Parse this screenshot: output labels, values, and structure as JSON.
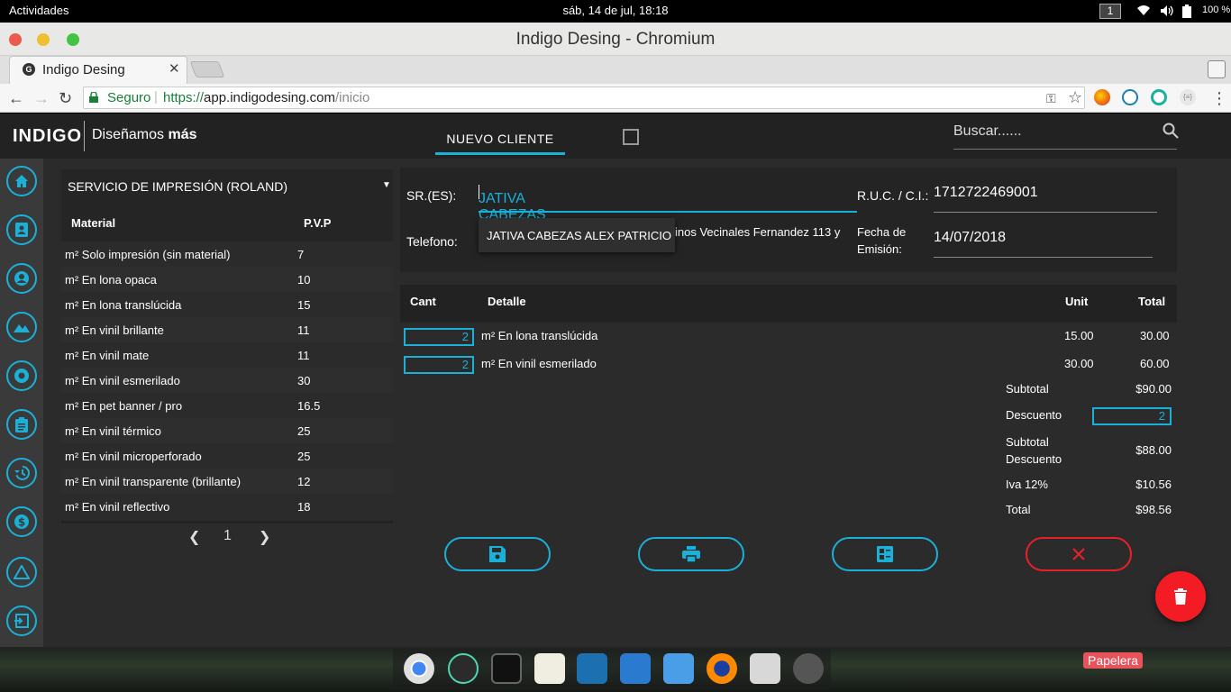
{
  "topbar": {
    "activities": "Actividades",
    "clock": "sáb, 14 de jul, 18:18",
    "workspace": "1",
    "battery": "100 %"
  },
  "window": {
    "title": "Indigo Desing - Chromium"
  },
  "browser": {
    "tab_title": "Indigo Desing",
    "secure_label": "Seguro",
    "url_scheme": "https://",
    "url_host": "app.indigodesing.com",
    "url_path": "/inicio"
  },
  "app": {
    "logo": "INDIGO",
    "tagline_regular": "Diseñamos ",
    "tagline_bold": "más",
    "nuevo_cliente": "NUEVO CLIENTE",
    "search_placeholder": "Buscar......",
    "accent": "#1ab0d8",
    "danger": "#f41c24"
  },
  "sidebar": {
    "icons": [
      "home-icon",
      "contacts-icon",
      "account-icon",
      "landscape-icon",
      "camera-icon",
      "assignment-icon",
      "history-icon",
      "money-icon",
      "warning-icon",
      "exit-icon"
    ]
  },
  "services": {
    "selected": "SERVICIO DE IMPRESIÓN (ROLAND)",
    "columns": [
      "Material",
      "P.V.P"
    ],
    "rows": [
      {
        "name": "m² Solo impresión (sin material)",
        "price": "7"
      },
      {
        "name": "m² En lona opaca",
        "price": "10"
      },
      {
        "name": "m² En lona translúcida",
        "price": "15"
      },
      {
        "name": "m² En vinil brillante",
        "price": "11"
      },
      {
        "name": "m² En vinil mate",
        "price": "11"
      },
      {
        "name": "m² En vinil esmerilado",
        "price": "30"
      },
      {
        "name": "m² En pet banner / pro",
        "price": "16.5"
      },
      {
        "name": "m² En vinil térmico",
        "price": "25"
      },
      {
        "name": "m² En vinil microperforado",
        "price": "25"
      },
      {
        "name": "m² En vinil transparente (brillante)",
        "price": "12"
      },
      {
        "name": "m² En vinil reflectivo",
        "price": "18"
      }
    ],
    "page": "1"
  },
  "form": {
    "sr_label": "SR.(ES):",
    "sr_value": "JATIVA CABEZAS ALEX PATRICIO",
    "ruc_label": "R.U.C. / C.I.:",
    "ruc_value": "1712722469001",
    "telefono_label": "Telefono:",
    "address_partial": "inos Vecinales Fernandez 113 y",
    "fecha_label_1": "Fecha de",
    "fecha_label_2": "Emisión:",
    "fecha_value": "14/07/2018",
    "autocomplete_option": "JATIVA CABEZAS ALEX PATRICIO"
  },
  "detail": {
    "columns": {
      "cant": "Cant",
      "detalle": "Detalle",
      "unit": "Unit",
      "total": "Total"
    },
    "rows": [
      {
        "cant": "2",
        "detalle": "m² En lona translúcida",
        "unit": "15.00",
        "total": "30.00"
      },
      {
        "cant": "2",
        "detalle": "m² En vinil esmerilado",
        "unit": "30.00",
        "total": "60.00"
      }
    ],
    "subtotal_label": "Subtotal",
    "subtotal_value": "$90.00",
    "descuento_label": "Descuento",
    "descuento_value": "2",
    "subtotal_desc_label_1": "Subtotal",
    "subtotal_desc_label_2": "Descuento",
    "subtotal_desc_value": "$88.00",
    "iva_label": "Iva 12%",
    "iva_value": "$10.56",
    "total_label": "Total",
    "total_value": "$98.56"
  },
  "dock": {
    "trash_label": "Papelera"
  }
}
